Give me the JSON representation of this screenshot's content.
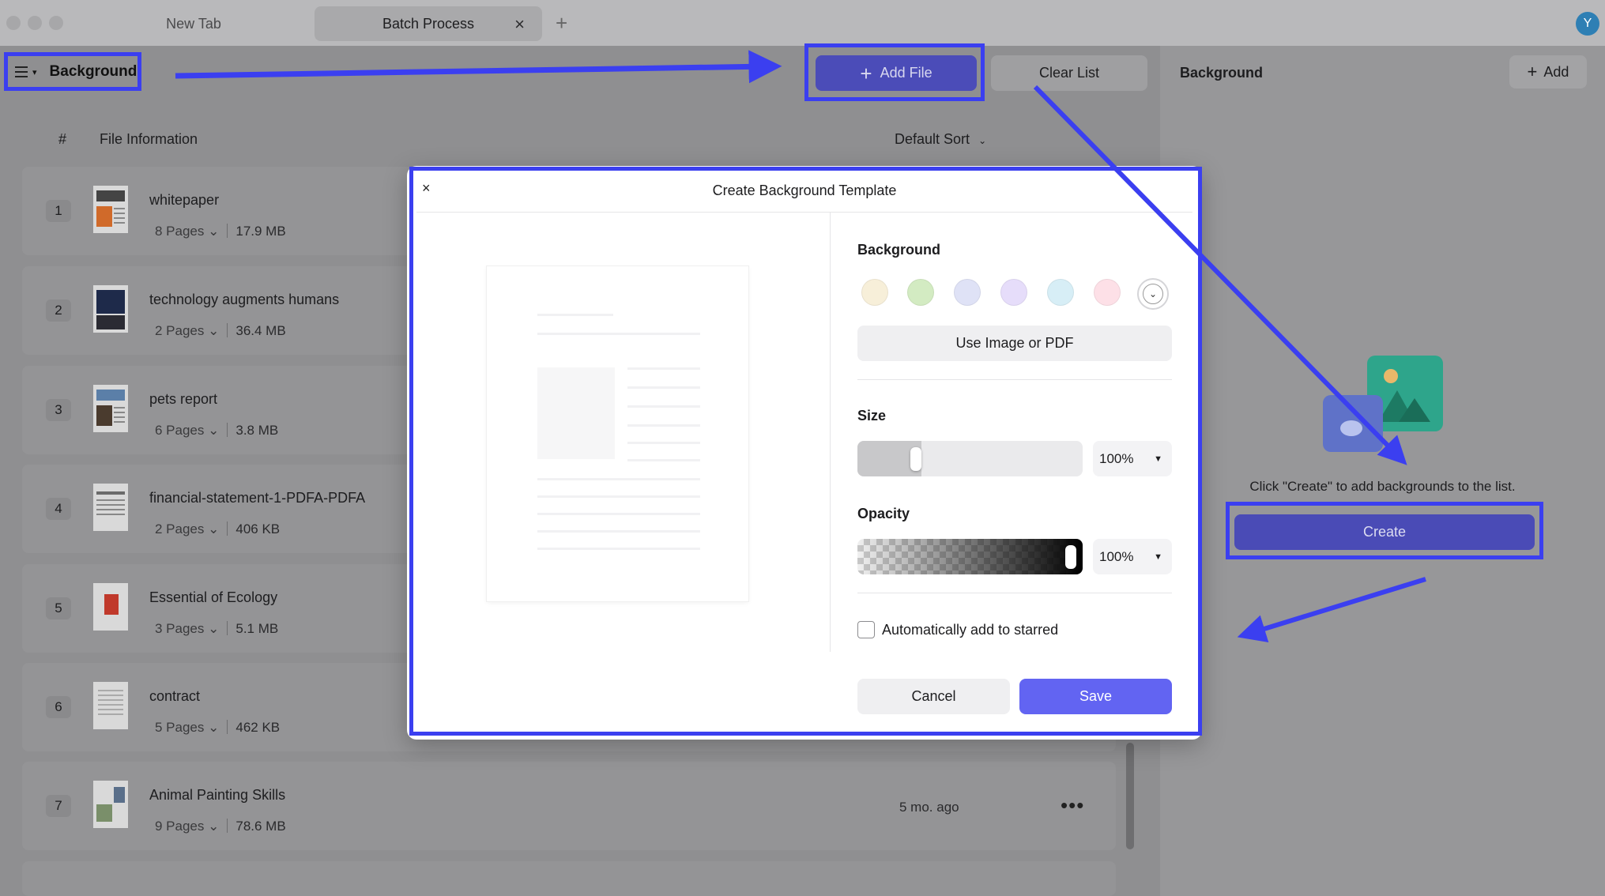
{
  "titlebar": {
    "tabs": [
      {
        "label": "New Tab"
      },
      {
        "label": "Batch Process"
      }
    ],
    "tab_close_glyph": "×",
    "new_tab_glyph": "+",
    "avatar_letter": "Y"
  },
  "toolbar": {
    "menu_label": "Background",
    "add_file_label": "Add File",
    "clear_list_label": "Clear List"
  },
  "list": {
    "col_number": "#",
    "col_info": "File Information",
    "sort_label": "Default Sort",
    "pages_chevron": "⌄",
    "files": [
      {
        "index": "1",
        "name": "whitepaper",
        "pages": "8 Pages",
        "size": "17.9 MB"
      },
      {
        "index": "2",
        "name": "technology augments humans",
        "pages": "2 Pages",
        "size": "36.4 MB"
      },
      {
        "index": "3",
        "name": "pets report",
        "pages": "6 Pages",
        "size": "3.8 MB"
      },
      {
        "index": "4",
        "name": "financial-statement-1-PDFA-PDFA",
        "pages": "2 Pages",
        "size": "406 KB"
      },
      {
        "index": "5",
        "name": "Essential of Ecology",
        "pages": "3 Pages",
        "size": "5.1 MB"
      },
      {
        "index": "6",
        "name": "contract",
        "pages": "5 Pages",
        "size": "462 KB"
      },
      {
        "index": "7",
        "name": "Animal Painting Skills",
        "pages": "9 Pages",
        "size": "78.6 MB",
        "date": "5 mo. ago",
        "more": "•••"
      }
    ]
  },
  "right_panel": {
    "title": "Background",
    "add_label": "Add",
    "hint": "Click \"Create\" to add backgrounds to the list.",
    "create_label": "Create"
  },
  "dialog": {
    "close_glyph": "×",
    "title": "Create Background Template",
    "background_label": "Background",
    "swatch_colors": [
      "#f7efd9",
      "#d3ebc2",
      "#dfe2f6",
      "#e6ddfa",
      "#d7eef6",
      "#fde0e7"
    ],
    "use_image_label": "Use Image or PDF",
    "size_label": "Size",
    "size_value": "100%",
    "size_slider_level": 0.23,
    "opacity_label": "Opacity",
    "opacity_value": "100%",
    "opacity_slider_level": 1.0,
    "auto_star_label": "Automatically add to starred",
    "auto_star_checked": false,
    "cancel_label": "Cancel",
    "save_label": "Save"
  },
  "colors": {
    "accent": "#4b4cb8",
    "save": "#6264f2",
    "annotation": "#3b3ff0"
  }
}
